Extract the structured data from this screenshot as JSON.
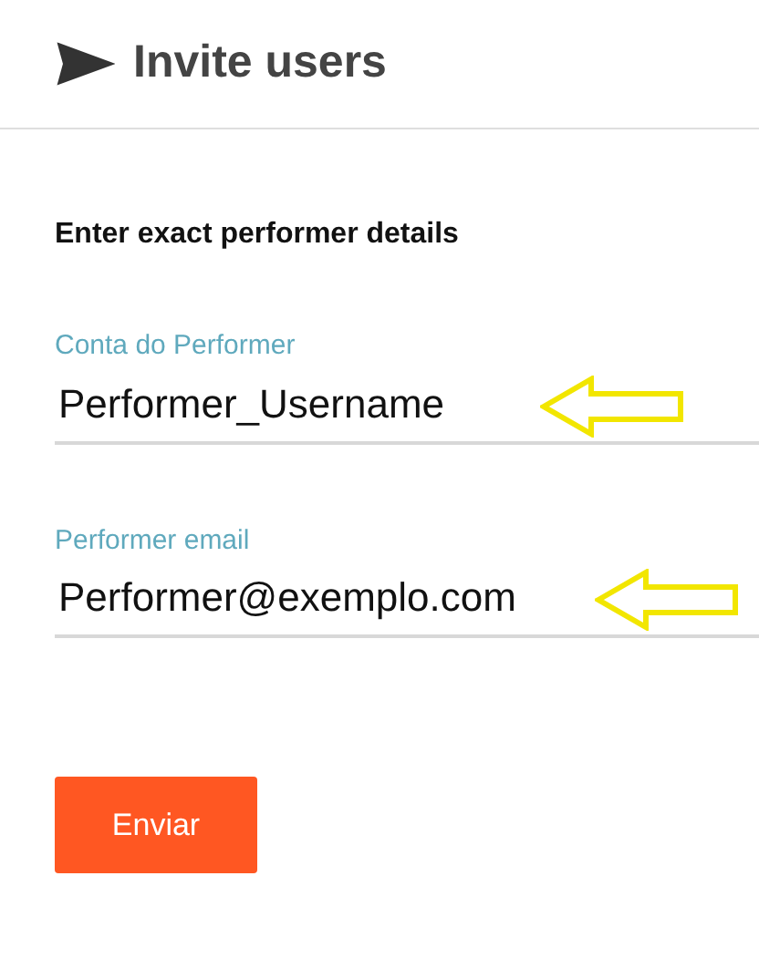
{
  "header": {
    "title": "Invite users"
  },
  "form": {
    "heading": "Enter exact performer details",
    "fields": [
      {
        "label": "Conta do Performer",
        "value": "Performer_Username"
      },
      {
        "label": "Performer email",
        "value": "Performer@exemplo.com"
      }
    ],
    "submit": "Enviar"
  }
}
